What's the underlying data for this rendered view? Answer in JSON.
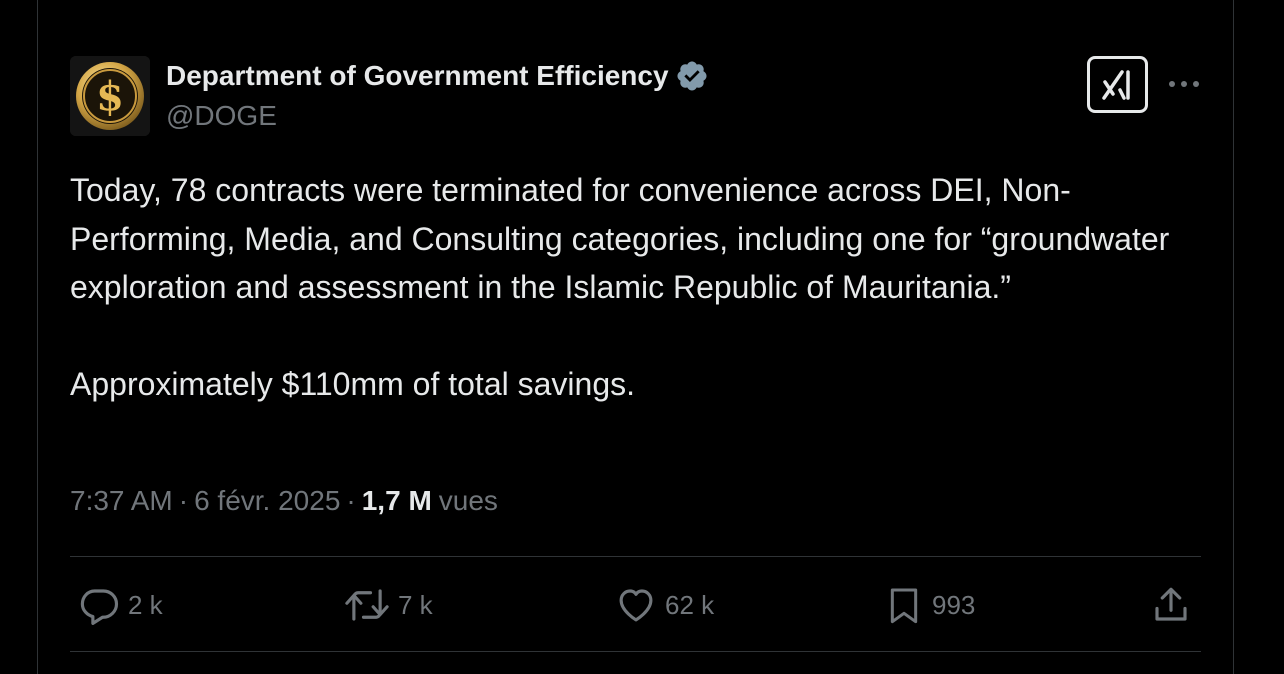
{
  "author": {
    "display_name": "Department of Government Efficiency",
    "handle": "@DOGE",
    "verified": true,
    "avatar_icon": "gold-dollar-coin-icon"
  },
  "header_actions": {
    "grok_icon": "grok-icon",
    "more_icon": "more-horizontal-icon"
  },
  "tweet": {
    "paragraph_1": "Today, 78 contracts were terminated for convenience across DEI, Non-Performing, Media, and Consulting categories, including one for “groundwater exploration and assessment in the Islamic Republic of Mauritania.”",
    "paragraph_2": "Approximately $110mm of total savings."
  },
  "meta": {
    "time": "7:37 AM",
    "date": "6 févr. 2025",
    "views_count": "1,7 M",
    "views_label": "vues",
    "separator": "·"
  },
  "actions": {
    "reply": {
      "icon": "reply-icon",
      "count": "2 k"
    },
    "retweet": {
      "icon": "retweet-icon",
      "count": "7 k"
    },
    "like": {
      "icon": "heart-icon",
      "count": "62 k"
    },
    "bookmark": {
      "icon": "bookmark-icon",
      "count": "993"
    },
    "share": {
      "icon": "share-icon"
    }
  },
  "colors": {
    "background": "#000000",
    "text_primary": "#e7e9ea",
    "text_secondary": "#71767b",
    "border": "#2f3336",
    "verified_badge": "#829aab",
    "avatar_gold": "#d4a646"
  }
}
